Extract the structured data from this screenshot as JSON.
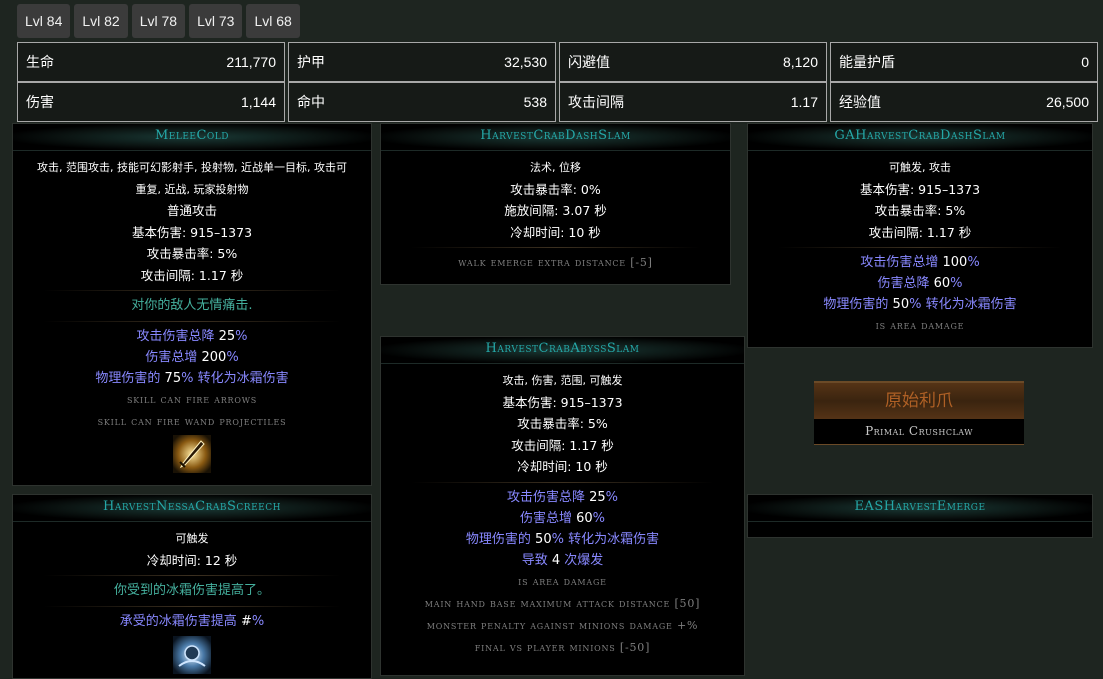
{
  "tabs": [
    "Lvl 84",
    "Lvl 82",
    "Lvl 78",
    "Lvl 73",
    "Lvl 68"
  ],
  "stats": [
    {
      "label": "生命",
      "value": "211,770"
    },
    {
      "label": "护甲",
      "value": "32,530"
    },
    {
      "label": "闪避值",
      "value": "8,120"
    },
    {
      "label": "能量护盾",
      "value": "0"
    },
    {
      "label": "伤害",
      "value": "1,144"
    },
    {
      "label": "命中",
      "value": "538"
    },
    {
      "label": "攻击间隔",
      "value": "1.17"
    },
    {
      "label": "经验值",
      "value": "26,500"
    }
  ],
  "melee_cold": {
    "title": "MeleeCold",
    "tags_line1": "攻击, 范围攻击, 技能可幻影射手, 投射物, 近战单一目标, 攻击可",
    "tags_line2": "重复, 近战, 玩家投射物",
    "type": "普通攻击",
    "base_damage": "基本伤害: 915–1373",
    "crit": "攻击暴击率: 5%",
    "attack_time": "攻击间隔: 1.17 秒",
    "flavour": "对你的敌人无情痛击.",
    "mod1_a": "攻击伤害总降",
    "mod1_b": "25",
    "mod1_c": "%",
    "mod2_a": "伤害总增",
    "mod2_b": "200",
    "mod2_c": "%",
    "mod3_a": "物理伤害的",
    "mod3_b": "75",
    "mod3_c": "% 转化为冰霜伤害",
    "stat1": "skill can fire arrows",
    "stat2": "skill can fire wand projectiles",
    "icon": "sword-skill-icon"
  },
  "dash_slam": {
    "title": "HarvestCrabDashSlam",
    "tags": "法术, 位移",
    "crit": "攻击暴击率: 0%",
    "cast_time": "施放间隔: 3.07 秒",
    "cooldown": "冷却时间: 10 秒",
    "stat1": "walk emerge extra distance [-5]"
  },
  "ga_dash_slam": {
    "title": "GAHarvestCrabDashSlam",
    "tags": "可触发, 攻击",
    "base_damage": "基本伤害: 915–1373",
    "crit": "攻击暴击率: 5%",
    "attack_time": "攻击间隔: 1.17 秒",
    "mod1_a": "攻击伤害总增",
    "mod1_b": "100",
    "mod1_c": "%",
    "mod2_a": "伤害总降",
    "mod2_b": "60",
    "mod2_c": "%",
    "mod3_a": "物理伤害的",
    "mod3_b": "50",
    "mod3_c": "% 转化为冰霜伤害",
    "stat1": "is area damage"
  },
  "abyss_slam": {
    "title": "HarvestCrabAbyssSlam",
    "tags": "攻击, 伤害, 范围, 可触发",
    "base_damage": "基本伤害: 915–1373",
    "crit": "攻击暴击率: 5%",
    "attack_time": "攻击间隔: 1.17 秒",
    "cooldown": "冷却时间: 10 秒",
    "mod1_a": "攻击伤害总降",
    "mod1_b": "25",
    "mod1_c": "%",
    "mod2_a": "伤害总增",
    "mod2_b": "60",
    "mod2_c": "%",
    "mod3_a": "物理伤害的",
    "mod3_b": "50",
    "mod3_c": "% 转化为冰霜伤害",
    "mod4_a": "导致",
    "mod4_b": "4",
    "mod4_c": "次爆发",
    "stat1": "is area damage",
    "stat2": "main hand base maximum attack distance [50]",
    "stat3": "monster penalty against minions damage +%",
    "stat4": "final vs player minions [-50]"
  },
  "nessa_screech": {
    "title": "HarvestNessaCrabScreech",
    "tags": "可触发",
    "cooldown": "冷却时间: 12 秒",
    "flavour": "你受到的冰霜伤害提高了。",
    "mod1_a": "承受的冰霜伤害提高",
    "mod1_b": "#",
    "mod1_c": "%",
    "icon": "screech-skill-icon"
  },
  "unique_item": {
    "name": "原始利爪",
    "base": "Primal Crushclaw"
  },
  "eas_emerge": {
    "title": "EASHarvestEmerge"
  }
}
